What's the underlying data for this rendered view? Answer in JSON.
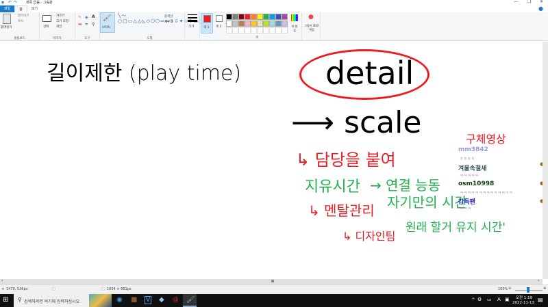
{
  "window": {
    "title": "제목 없음 - 그림판"
  },
  "tabs": [
    {
      "label": "파일"
    },
    {
      "label": "홈"
    },
    {
      "label": "보기"
    }
  ],
  "ribbon": {
    "clipboard": {
      "label": "클립보드",
      "paste": "붙여넣기",
      "cut": "잘라내기",
      "copy": "복사"
    },
    "image": {
      "label": "이미지",
      "select": "선택",
      "crop": "자르기",
      "resize": "크기 조정",
      "rotate": "회전"
    },
    "tools": {
      "label": "도구"
    },
    "brushes": {
      "label": "브러시"
    },
    "shapes": {
      "label": "도형",
      "outline": "윤곽선",
      "fill": "채우기"
    },
    "size": {
      "label": "크기"
    },
    "color1": {
      "label": "색 1"
    },
    "color2": {
      "label": "색 2"
    },
    "colors": {
      "label": "색",
      "edit": "색 편집"
    },
    "paint3d": {
      "label": "그림판 3D로 편집"
    },
    "palette": [
      "#000000",
      "#7f7f7f",
      "#880015",
      "#ed1c24",
      "#ff7f27",
      "#fff200",
      "#22b14c",
      "#00a2e8",
      "#3f48cc",
      "#a349a4",
      "#ffffff",
      "#c3c3c3",
      "#b97a57",
      "#ffaec9",
      "#ffc90e",
      "#efe4b0",
      "#b5e61d",
      "#99d9ea",
      "#7092be",
      "#c8bfe7"
    ]
  },
  "canvas": {
    "notes": [
      {
        "text": "길이제한 (play time)",
        "color": "#000000"
      },
      {
        "text": "detail",
        "color": "#000000"
      },
      {
        "text": "⟶ scale",
        "color": "#000000"
      },
      {
        "text": "구체영상",
        "color": "#ed1c24"
      },
      {
        "text": "↳ 담당을 붙여",
        "color": "#ed1c24"
      },
      {
        "text": "지유시간",
        "color": "#22b14c"
      },
      {
        "text": "→ 연결 능동",
        "color": "#22b14c"
      },
      {
        "text": "자기만의 시간",
        "color": "#22b14c"
      },
      {
        "text": "↳ 멘탈관리",
        "color": "#ed1c24"
      },
      {
        "text": "↳ 디자인팀",
        "color": "#ed1c24"
      },
      {
        "text": "원래 할거 유지 시간'",
        "color": "#22b14c"
      }
    ]
  },
  "chat": [
    {
      "user": "mm3842",
      "msg": "ㅎㅎㅎㅎ",
      "color": "#9a9ae0"
    },
    {
      "user": "겨울속철새",
      "msg": "ㅋㅋㅋㅋㅋ",
      "color": "#2f4f4f"
    },
    {
      "user": "osm10998",
      "msg": "ㅋㅋㅋㅋㅋㅋㅋㅋㅋㅋㅋㅋㅋㅋ",
      "color": "#0b3d0b"
    },
    {
      "user": "감득팬",
      "msg": "ㅋㅋㅋ",
      "color": "#1a1ad0"
    }
  ],
  "status": {
    "cursor": "1479, 536px",
    "size": "1604 × 661px",
    "zoom": "100%",
    "zoom_value": 100
  },
  "taskbar": {
    "search_placeholder": "검색하려면 여기에 입력하십시오",
    "time": "오전 1:19",
    "date": "2022-11-13",
    "ime": "A"
  }
}
